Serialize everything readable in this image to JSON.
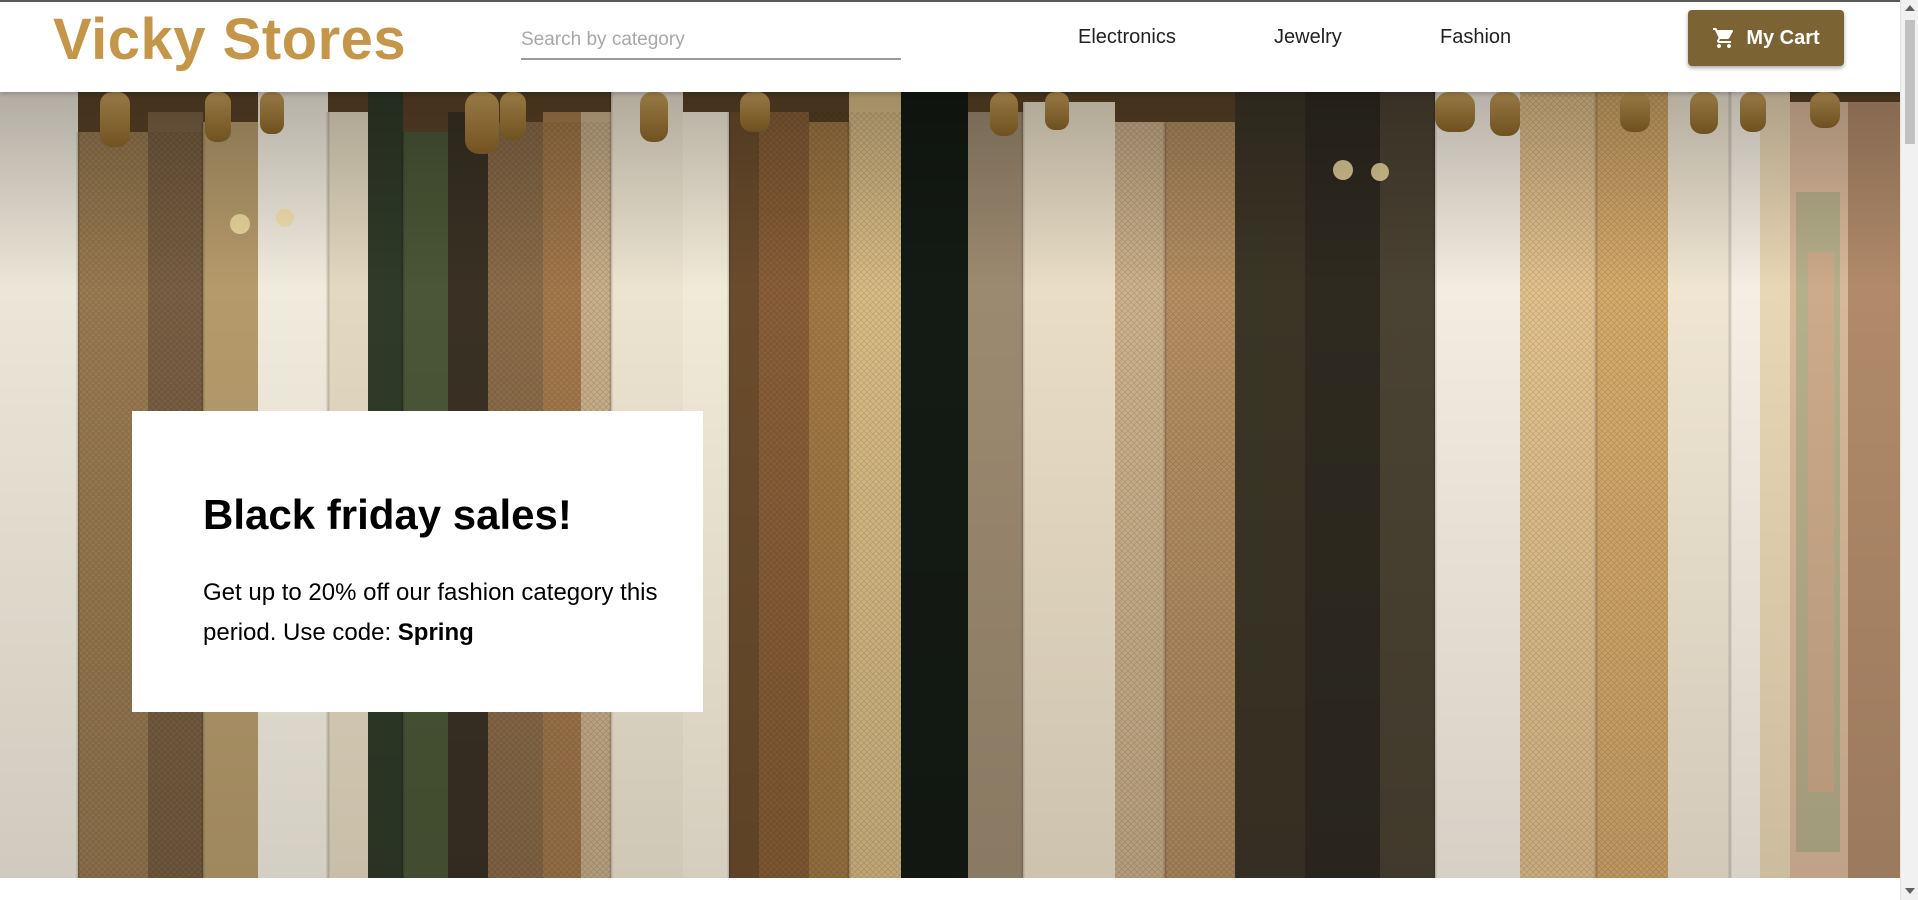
{
  "header": {
    "brand": "Vicky Stores",
    "search": {
      "placeholder": "Search by category",
      "value": ""
    },
    "nav": [
      {
        "label": "Electronics"
      },
      {
        "label": "Jewelry"
      },
      {
        "label": "Fashion"
      }
    ],
    "cart": {
      "label": "My Cart",
      "icon": "cart-icon"
    }
  },
  "hero": {
    "image": "clothes-rack-photo",
    "promo": {
      "title": "Black friday sales!",
      "text": "Get up to 20% off our fashion category this period. Use code: ",
      "code": "Spring"
    }
  },
  "colors": {
    "brand": "#c4964a",
    "cart_button": "#7b6334",
    "promo_background": "#ffffff"
  }
}
